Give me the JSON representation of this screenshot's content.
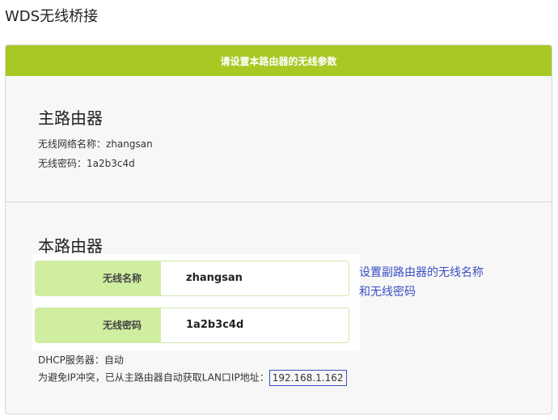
{
  "page": {
    "title": "WDS无线桥接"
  },
  "panel": {
    "header": "请设置本路由器的无线参数"
  },
  "main_router": {
    "heading": "主路由器",
    "ssid_label": "无线网络名称：",
    "ssid_value": "zhangsan",
    "password_label": "无线密码：",
    "password_value": "1a2b3c4d"
  },
  "local_router": {
    "heading": "本路由器",
    "ssid_label": "无线名称",
    "ssid_value": "zhangsan",
    "password_label": "无线密码",
    "password_value": "1a2b3c4d",
    "hint": "设置副路由器的无线名称和无线密码",
    "dhcp_label": "DHCP服务器：",
    "dhcp_value": "自动",
    "ip_prefix": "为避免IP冲突，已从主路由器自动获取LAN口IP地址：",
    "ip_value": "192.168.1.162"
  },
  "colors": {
    "accent": "#a8c824",
    "label_bg": "#cfeea0",
    "link": "#3a4fc2"
  }
}
